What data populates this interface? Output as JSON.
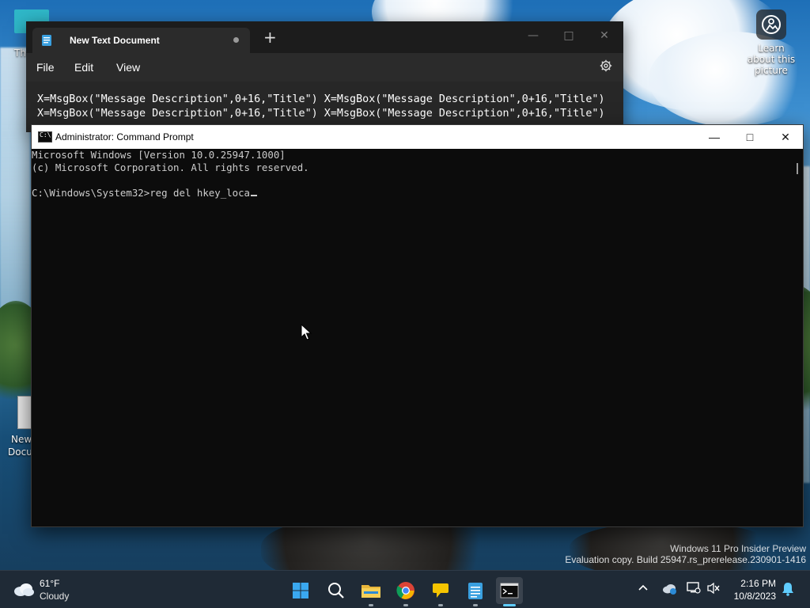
{
  "desktop": {
    "learn_about": "Learn about this picture",
    "icon_top_label": "Th",
    "icon_doc_label_1": "New",
    "icon_doc_label_2": "Docu",
    "watermark_line1": "Windows 11 Pro Insider Preview",
    "watermark_line2": "Evaluation copy. Build 25947.rs_prerelease.230901-1416"
  },
  "notepad": {
    "tab_title": "New Text Document",
    "new_tab_glyph": "+",
    "menu": [
      "File",
      "Edit",
      "View"
    ],
    "lines": [
      "X=MsgBox(\"Message Description\",0+16,\"Title\") X=MsgBox(\"Message Description\",0+16,\"Title\")",
      "X=MsgBox(\"Message Description\",0+16,\"Title\") X=MsgBox(\"Message Description\",0+16,\"Title\")"
    ]
  },
  "cmd": {
    "title": "Administrator: Command Prompt",
    "lines": [
      "Microsoft Windows [Version 10.0.25947.1000]",
      "(c) Microsoft Corporation. All rights reserved.",
      "",
      "C:\\Windows\\System32>reg del hkey_loca"
    ]
  },
  "taskbar": {
    "weather_temp": "61°F",
    "weather_cond": "Cloudy",
    "time": "2:16 PM",
    "date": "10/8/2023",
    "apps": [
      "start-icon",
      "search-icon",
      "file-explorer-icon",
      "chrome-icon",
      "feedback-hub-icon",
      "notepad-icon",
      "terminal-icon"
    ]
  }
}
